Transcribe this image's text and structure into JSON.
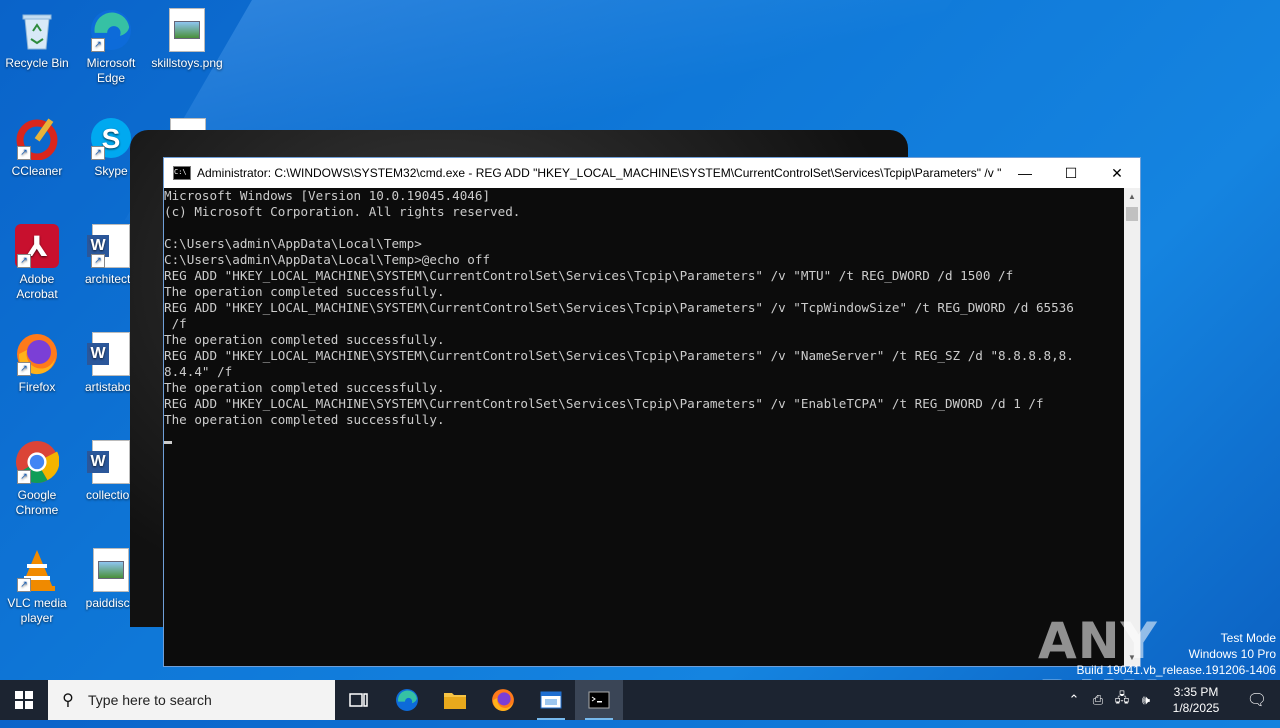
{
  "desktop": {
    "icons_col1": [
      {
        "label": "Recycle Bin",
        "icon": "recycle-bin-icon"
      },
      {
        "label": "CCleaner",
        "icon": "ccleaner-icon"
      },
      {
        "label": "Adobe Acrobat",
        "icon": "adobe-acrobat-icon"
      },
      {
        "label": "Firefox",
        "icon": "firefox-icon"
      },
      {
        "label": "Google Chrome",
        "icon": "chrome-icon"
      },
      {
        "label": "VLC media player",
        "icon": "vlc-icon"
      }
    ],
    "icons_col2": [
      {
        "label": "Microsoft Edge",
        "icon": "edge-icon"
      },
      {
        "label": "Skype",
        "icon": "skype-icon"
      },
      {
        "label": "architectu",
        "icon": "word-doc-icon"
      },
      {
        "label": "artistabov",
        "icon": "word-doc-icon"
      },
      {
        "label": "collection",
        "icon": "word-doc-icon"
      },
      {
        "label": "paiddisco",
        "icon": "image-file-icon"
      }
    ],
    "icons_col3": [
      {
        "label": "skillstoys.png",
        "icon": "image-file-icon"
      }
    ]
  },
  "cmd_window": {
    "title": "Administrator: C:\\WINDOWS\\SYSTEM32\\cmd.exe - REG  ADD \"HKEY_LOCAL_MACHINE\\SYSTEM\\CurrentControlSet\\Services\\Tcpip\\Parameters\" /v \"Ena...",
    "minimize": "—",
    "maximize": "☐",
    "close": "✕",
    "lines": [
      "Microsoft Windows [Version 10.0.19045.4046]",
      "(c) Microsoft Corporation. All rights reserved.",
      "",
      "C:\\Users\\admin\\AppData\\Local\\Temp>",
      "C:\\Users\\admin\\AppData\\Local\\Temp>@echo off",
      "REG ADD \"HKEY_LOCAL_MACHINE\\SYSTEM\\CurrentControlSet\\Services\\Tcpip\\Parameters\" /v \"MTU\" /t REG_DWORD /d 1500 /f",
      "The operation completed successfully.",
      "REG ADD \"HKEY_LOCAL_MACHINE\\SYSTEM\\CurrentControlSet\\Services\\Tcpip\\Parameters\" /v \"TcpWindowSize\" /t REG_DWORD /d 65536",
      " /f",
      "The operation completed successfully.",
      "REG ADD \"HKEY_LOCAL_MACHINE\\SYSTEM\\CurrentControlSet\\Services\\Tcpip\\Parameters\" /v \"NameServer\" /t REG_SZ /d \"8.8.8.8,8.",
      "8.4.4\" /f",
      "The operation completed successfully.",
      "REG ADD \"HKEY_LOCAL_MACHINE\\SYSTEM\\CurrentControlSet\\Services\\Tcpip\\Parameters\" /v \"EnableTCPA\" /t REG_DWORD /d 1 /f",
      "The operation completed successfully."
    ]
  },
  "watermark": {
    "brand": "ANY RUN",
    "line1": "Test Mode",
    "line2": "Windows 10 Pro",
    "line3": "Build 19041.vb_release.191206-1406"
  },
  "taskbar": {
    "search_placeholder": "Type here to search",
    "time": "3:35 PM",
    "date": "1/8/2025"
  }
}
